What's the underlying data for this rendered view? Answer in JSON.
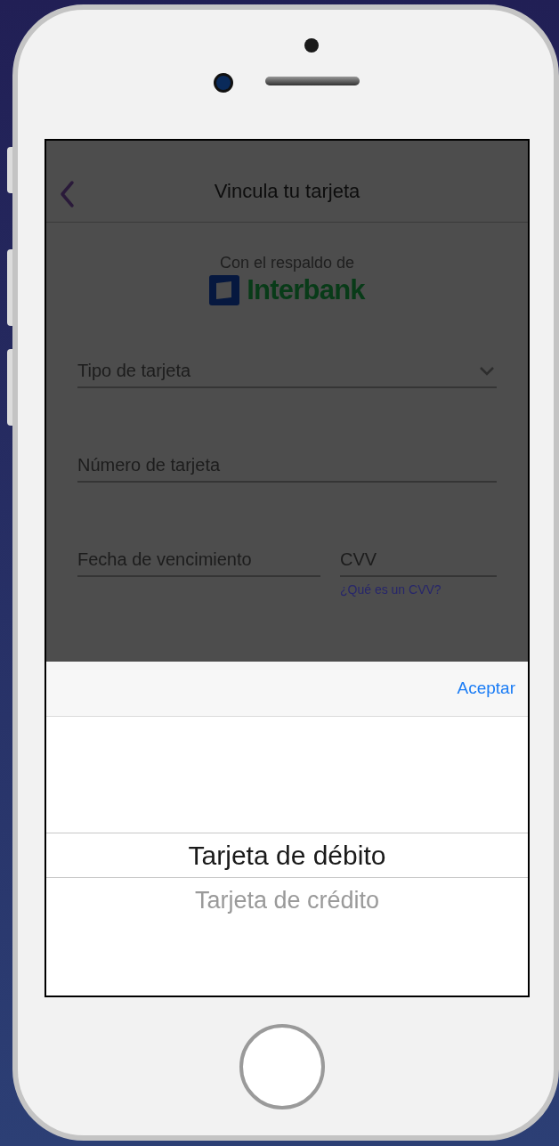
{
  "header": {
    "title": "Vincula tu tarjeta"
  },
  "sponsor": {
    "caption": "Con el respaldo de",
    "brand": "Interbank"
  },
  "fields": [
    {
      "kind": "dropdown",
      "placeholder": "Tipo de tarjeta"
    },
    {
      "kind": "text",
      "placeholder": "Número de tarjeta"
    }
  ],
  "expiry": {
    "placeholder": "Fecha de vencimiento"
  },
  "cvv": {
    "placeholder": "CVV",
    "help_link": "¿Qué es un CVV?"
  },
  "picker": {
    "done_button": "Aceptar",
    "options": [
      {
        "label": "Tarjeta de débito",
        "selected": true
      },
      {
        "label": "Tarjeta de crédito",
        "selected": false
      }
    ]
  }
}
